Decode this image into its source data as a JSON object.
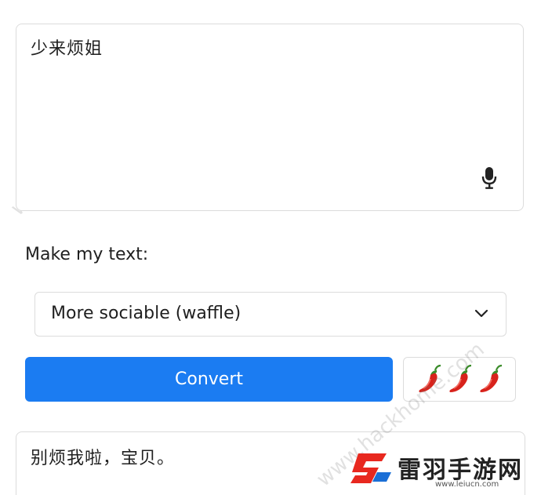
{
  "input": {
    "text": "少来烦姐"
  },
  "icons": {
    "mic": "microphone-icon",
    "chevron": "chevron-down-icon",
    "pepper": "chili-pepper-icon"
  },
  "make_label": "Make my text:",
  "select": {
    "value": "More sociable (waffle)"
  },
  "convert": {
    "label": "Convert",
    "color": "#1b7cf2"
  },
  "spice": {
    "level": 3
  },
  "output": {
    "text": "别烦我啦，宝贝。"
  },
  "watermark": {
    "text": "www.hackhome.com",
    "logo_text": "雷羽手游网",
    "logo_url": "www.leiucn.com"
  }
}
